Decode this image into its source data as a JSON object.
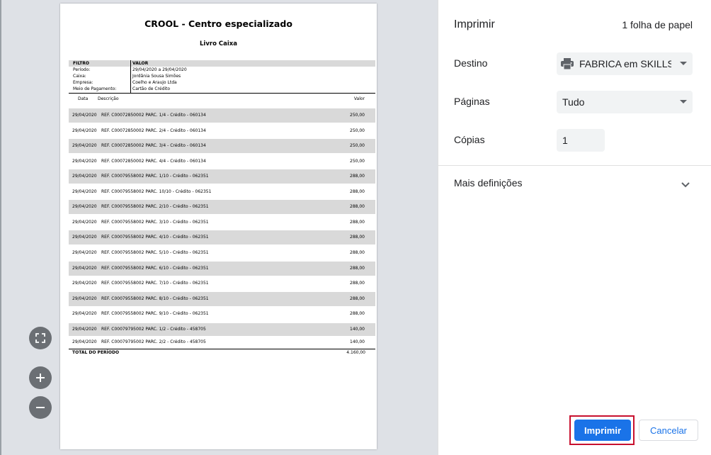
{
  "document": {
    "title": "CROOL - Centro especializado",
    "subtitle": "Livro Caixa",
    "filter_header": {
      "col1": "FILTRO",
      "col2": "VALOR"
    },
    "filters": [
      {
        "label": "Período:",
        "value": "29/04/2020  a  29/04/2020"
      },
      {
        "label": "Caixa:",
        "value": "Jordânia Sousa Simões"
      },
      {
        "label": "Empresa:",
        "value": "Coelho e Araujo Ltda"
      },
      {
        "label": "Meio de Pagamento:",
        "value": "Cartão de Crédito"
      }
    ],
    "columns": {
      "date": "Data",
      "description": "Descrição",
      "value": "Valor"
    },
    "rows": [
      {
        "date": "29/04/2020",
        "description": "REF. C00072850002  PARC. 1/4 - Crédito - 060134",
        "value": "250,00"
      },
      {
        "date": "29/04/2020",
        "description": "REF. C00072850002  PARC. 2/4 - Crédito - 060134",
        "value": "250,00"
      },
      {
        "date": "29/04/2020",
        "description": "REF. C00072850002  PARC. 3/4 - Crédito - 060134",
        "value": "250,00"
      },
      {
        "date": "29/04/2020",
        "description": "REF. C00072850002  PARC. 4/4 - Crédito - 060134",
        "value": "250,00"
      },
      {
        "date": "29/04/2020",
        "description": "REF. C00079558002  PARC. 1/10 - Crédito - 062351",
        "value": "288,00"
      },
      {
        "date": "29/04/2020",
        "description": "REF. C00079558002  PARC. 10/10 - Crédito - 062351",
        "value": "288,00"
      },
      {
        "date": "29/04/2020",
        "description": "REF. C00079558002  PARC. 2/10 - Crédito - 062351",
        "value": "288,00"
      },
      {
        "date": "29/04/2020",
        "description": "REF. C00079558002  PARC. 3/10 - Crédito - 062351",
        "value": "288,00"
      },
      {
        "date": "29/04/2020",
        "description": "REF. C00079558002  PARC. 4/10 - Crédito - 062351",
        "value": "288,00"
      },
      {
        "date": "29/04/2020",
        "description": "REF. C00079558002  PARC. 5/10 - Crédito - 062351",
        "value": "288,00"
      },
      {
        "date": "29/04/2020",
        "description": "REF. C00079558002  PARC. 6/10 - Crédito - 062351",
        "value": "288,00"
      },
      {
        "date": "29/04/2020",
        "description": "REF. C00079558002  PARC. 7/10 - Crédito - 062351",
        "value": "288,00"
      },
      {
        "date": "29/04/2020",
        "description": "REF. C00079558002  PARC. 8/10 - Crédito - 062351",
        "value": "288,00"
      },
      {
        "date": "29/04/2020",
        "description": "REF. C00079558002  PARC. 9/10 - Crédito - 062351",
        "value": "288,00"
      },
      {
        "date": "29/04/2020",
        "description": "REF. C00079795002  PARC. 1/2 - Crédito - 458705",
        "value": "140,00"
      },
      {
        "date": "29/04/2020",
        "description": "REF. C00079795002  PARC. 2/2 - Crédito - 458705",
        "value": "140,00"
      }
    ],
    "total_label": "TOTAL DO PERÍODO",
    "total_value": "4.160,00"
  },
  "zoom": {
    "fit_icon": "fit-to-page-icon",
    "zoom_in_icon": "plus-icon",
    "zoom_out_icon": "minus-icon"
  },
  "panel": {
    "title": "Imprimir",
    "sheet_count": "1 folha de papel",
    "destination_label": "Destino",
    "destination_value": "FABRICA em SKILLSERVER",
    "destination_icon": "printer-icon",
    "pages_label": "Páginas",
    "pages_value": "Tudo",
    "copies_label": "Cópias",
    "copies_value": "1",
    "more_settings": "Mais definições",
    "print_button": "Imprimir",
    "cancel_button": "Cancelar"
  },
  "colors": {
    "accent": "#1a73e8",
    "highlight": "#c8102e",
    "preview_bg": "#dee1e6",
    "row_shade": "#d9d9d9"
  }
}
